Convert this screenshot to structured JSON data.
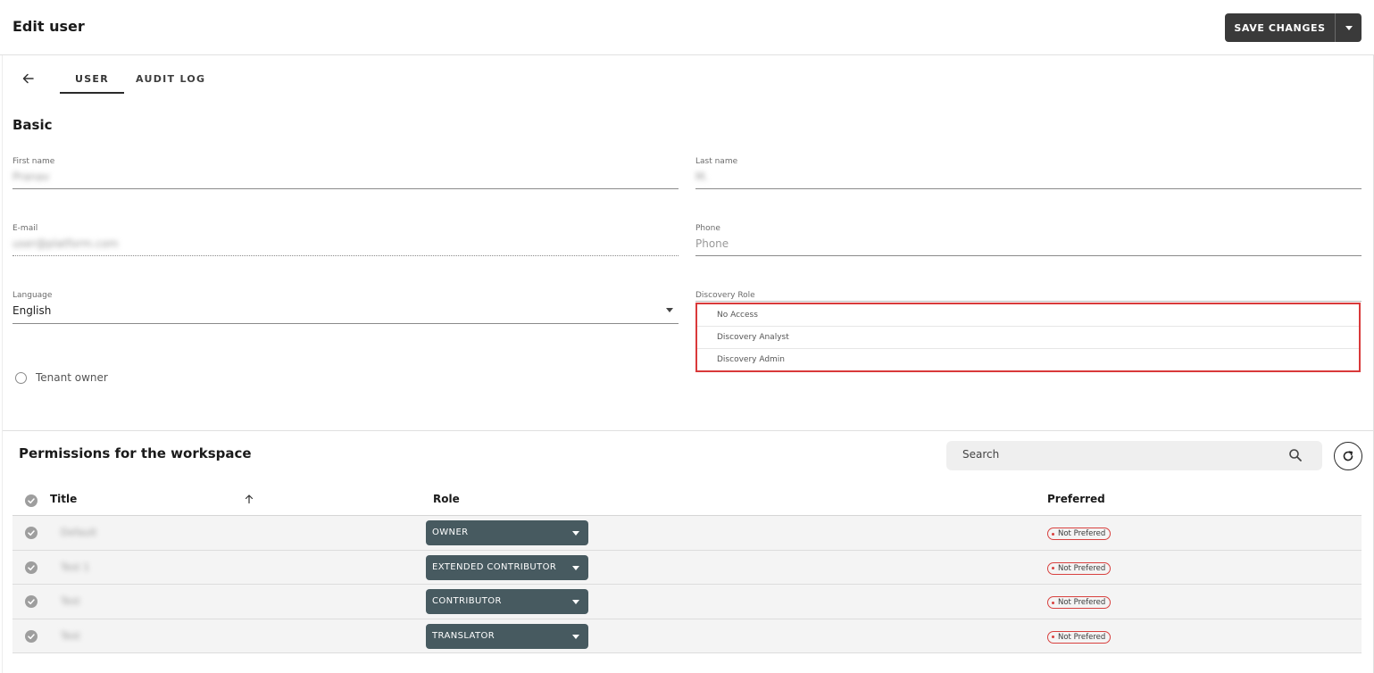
{
  "header": {
    "title": "Edit user",
    "save_label": "SAVE CHANGES"
  },
  "tabs": [
    {
      "label": "USER",
      "active": true
    },
    {
      "label": "AUDIT LOG",
      "active": false
    }
  ],
  "basic": {
    "section_title": "Basic",
    "first_name": {
      "label": "First name",
      "value": "Pranav"
    },
    "last_name": {
      "label": "Last name",
      "value": "M."
    },
    "email": {
      "label": "E-mail",
      "value": "user@platform.com"
    },
    "phone": {
      "label": "Phone",
      "placeholder": "Phone"
    },
    "language": {
      "label": "Language",
      "value": "English"
    },
    "discovery_role": {
      "label": "Discovery Role",
      "options": [
        "No Access",
        "Discovery Analyst",
        "Discovery Admin"
      ]
    },
    "tenant_owner": {
      "label": "Tenant owner",
      "checked": false
    }
  },
  "permissions": {
    "title": "Permissions for the workspace",
    "search_placeholder": "Search",
    "columns": {
      "title": "Title",
      "role": "Role",
      "preferred": "Preferred"
    },
    "rows": [
      {
        "title": "Default",
        "role": "OWNER",
        "preferred": "Not Prefered"
      },
      {
        "title": "Test 1",
        "role": "EXTENDED CONTRIBUTOR",
        "preferred": "Not Prefered"
      },
      {
        "title": "Test",
        "role": "CONTRIBUTOR",
        "preferred": "Not Prefered"
      },
      {
        "title": "Test",
        "role": "TRANSLATOR",
        "preferred": "Not Prefered"
      }
    ]
  },
  "colors": {
    "save_button": "#3a3a3a",
    "role_select": "#475a60",
    "highlight_border": "#d9393a",
    "badge_border": "#d8413f"
  },
  "icons": {
    "back": "arrow-left-icon",
    "search": "search-icon",
    "refresh": "refresh-icon",
    "sort": "arrow-up-icon",
    "row_check": "check-circle-icon",
    "dropdown": "caret-down-icon"
  }
}
